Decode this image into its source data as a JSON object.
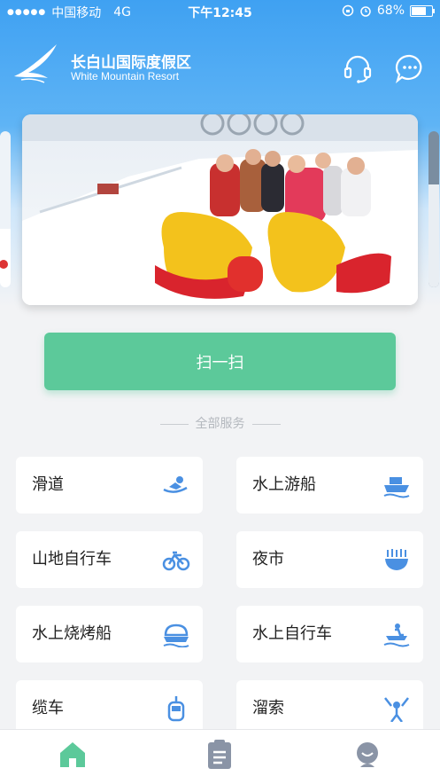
{
  "status_bar": {
    "carrier": "中国移动",
    "network": "4G",
    "time": "下午12:45",
    "battery": "68%"
  },
  "header": {
    "brand_cn": "长白山国际度假区",
    "brand_en": "White Mountain Resort"
  },
  "scan": {
    "label": "扫一扫"
  },
  "section": {
    "title": "全部服务"
  },
  "services": [
    {
      "label": "滑道",
      "icon": "slide-icon"
    },
    {
      "label": "水上游船",
      "icon": "boat-icon"
    },
    {
      "label": "山地自行车",
      "icon": "bicycle-icon"
    },
    {
      "label": "夜市",
      "icon": "food-bowl-icon"
    },
    {
      "label": "水上烧烤船",
      "icon": "bbq-boat-icon"
    },
    {
      "label": "水上自行车",
      "icon": "water-bike-icon"
    },
    {
      "label": "缆车",
      "icon": "cable-car-icon"
    },
    {
      "label": "溜索",
      "icon": "zipline-icon"
    }
  ],
  "tabbar": [
    {
      "name": "home",
      "icon": "home-icon",
      "active": true
    },
    {
      "name": "orders",
      "icon": "clipboard-icon",
      "active": false
    },
    {
      "name": "profile",
      "icon": "user-icon",
      "active": false
    }
  ],
  "colors": {
    "primary": "#4a90e2",
    "header_blue": "#3fa1f2",
    "scan_green": "#5cc99a",
    "tab_active": "#5cc99a",
    "tab_inactive": "#8a94a6"
  }
}
